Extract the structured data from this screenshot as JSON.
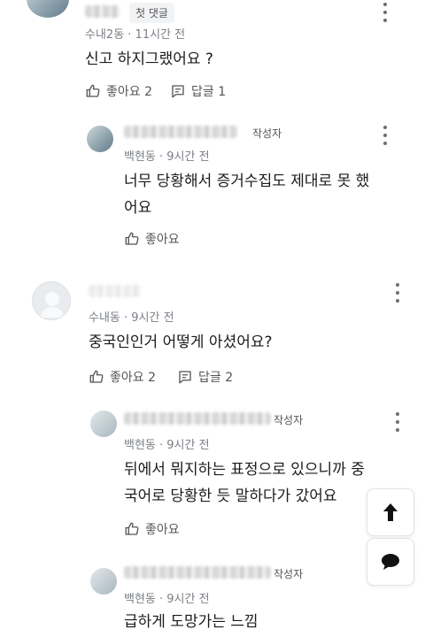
{
  "comments": [
    {
      "badge": "첫 댓글",
      "meta": "수내2동 · 11시간 전",
      "text": "신고 하지그랬어요 ?",
      "like_label": "좋아요 2",
      "reply_label": "답글 1"
    },
    {
      "badge": "작성자",
      "meta": "백현동 · 9시간 전",
      "text_lines": [
        "너무 당황해서 증거수집도 제대로 못 했",
        "어요"
      ],
      "like_label": "좋아요"
    },
    {
      "meta": "수내동 · 9시간 전",
      "text": "중국인인거 어떻게 아셨어요?",
      "like_label": "좋아요 2",
      "reply_label": "답글 2"
    },
    {
      "badge": "작성자",
      "meta": "백현동 · 9시간 전",
      "text_lines": [
        "뒤에서 뭐지하는 표정으로 있으니까 중",
        "국어로 당황한 듯 말하다가 갔어요"
      ],
      "like_label": "좋아요"
    },
    {
      "badge": "작성자",
      "meta": "백현동 · 9시간 전",
      "text": "급하게 도망가는 느낌"
    }
  ],
  "floating": {
    "scroll_top_icon": "arrow-up-icon",
    "chat_icon": "chat-bubble-icon"
  }
}
